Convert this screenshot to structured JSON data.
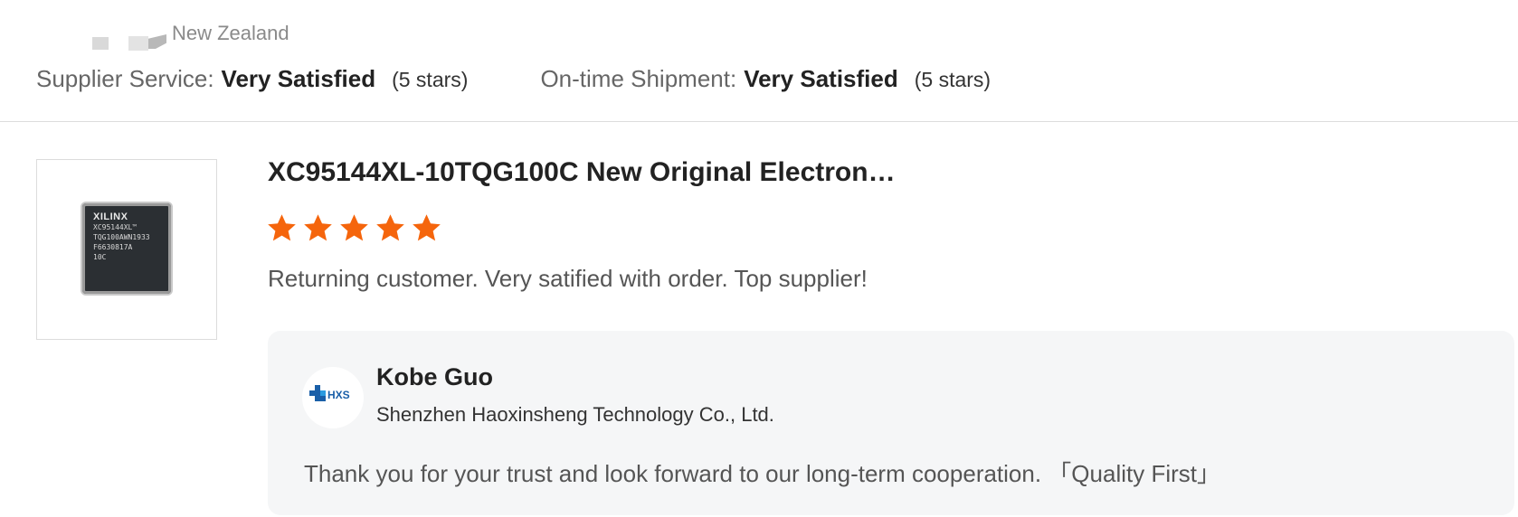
{
  "reviewer": {
    "country": "New Zealand"
  },
  "ratings": {
    "supplier_service": {
      "label": "Supplier Service:",
      "value": "Very Satisfied",
      "stars_text": "(5 stars)"
    },
    "ontime_shipment": {
      "label": "On-time Shipment:",
      "value": "Very Satisfied",
      "stars_text": "(5 stars)"
    }
  },
  "product": {
    "title": "XC95144XL-10TQG100C New Original Electron…",
    "chip_logo": "XILINX",
    "chip_marking": "XC95144XL™\nTQG100AWN1933\nF6630817A\n10C",
    "rating": 5,
    "rating_max": 5,
    "star_color": "#f5650c"
  },
  "review": {
    "text": "Returning customer. Very satified with order. Top supplier!"
  },
  "reply": {
    "seller_name": "Kobe Guo",
    "company": "Shenzhen Haoxinsheng Technology Co., Ltd.",
    "logo_text": "HXS",
    "logo_color": "#1a5fa8",
    "text": "Thank you for your trust and look forward to our long-term cooperation. 「Quality First」"
  }
}
